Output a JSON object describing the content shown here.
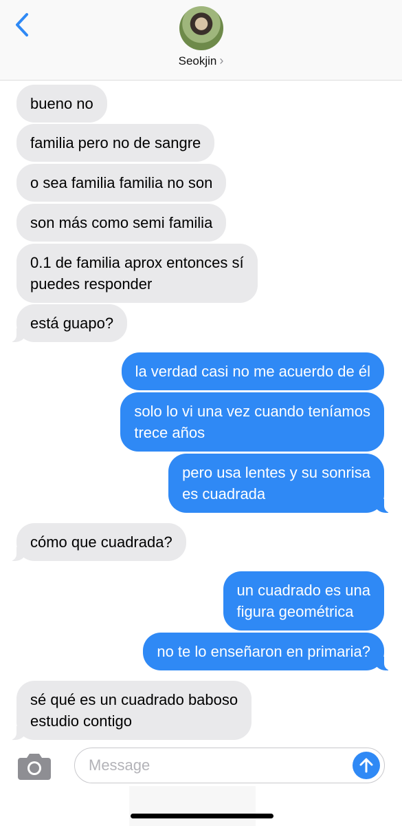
{
  "header": {
    "contact_name": "Seokjin",
    "chevron": "›",
    "back_icon": "chevron-left-icon",
    "accent_color": "#2f89f5"
  },
  "messages": [
    {
      "from": "contact",
      "lines": [
        "bueno no"
      ]
    },
    {
      "from": "contact",
      "lines": [
        "familia pero no de sangre"
      ]
    },
    {
      "from": "contact",
      "lines": [
        "o sea familia familia no son"
      ]
    },
    {
      "from": "contact",
      "lines": [
        "son más como semi familia"
      ]
    },
    {
      "from": "contact",
      "lines": [
        "0.1 de familia aprox entonces sí",
        "puedes responder"
      ]
    },
    {
      "from": "contact",
      "lines": [
        "está guapo?"
      ]
    },
    {
      "from": "me",
      "lines": [
        "la verdad casi no me acuerdo de él"
      ]
    },
    {
      "from": "me",
      "lines": [
        "solo lo vi una vez cuando teníamos",
        "trece años"
      ]
    },
    {
      "from": "me",
      "lines": [
        "pero usa lentes y su sonrisa",
        "es cuadrada"
      ]
    },
    {
      "from": "contact",
      "lines": [
        "cómo que cuadrada?"
      ]
    },
    {
      "from": "me",
      "lines": [
        "un cuadrado es una",
        "figura geométrica"
      ]
    },
    {
      "from": "me",
      "lines": [
        "no te lo enseñaron en primaria?"
      ]
    },
    {
      "from": "contact",
      "lines": [
        "sé qué es un cuadrado baboso",
        "estudio contigo"
      ]
    }
  ],
  "composer": {
    "placeholder": "Message",
    "value": "",
    "camera_icon": "camera-icon",
    "send_icon": "arrow-up-icon"
  }
}
